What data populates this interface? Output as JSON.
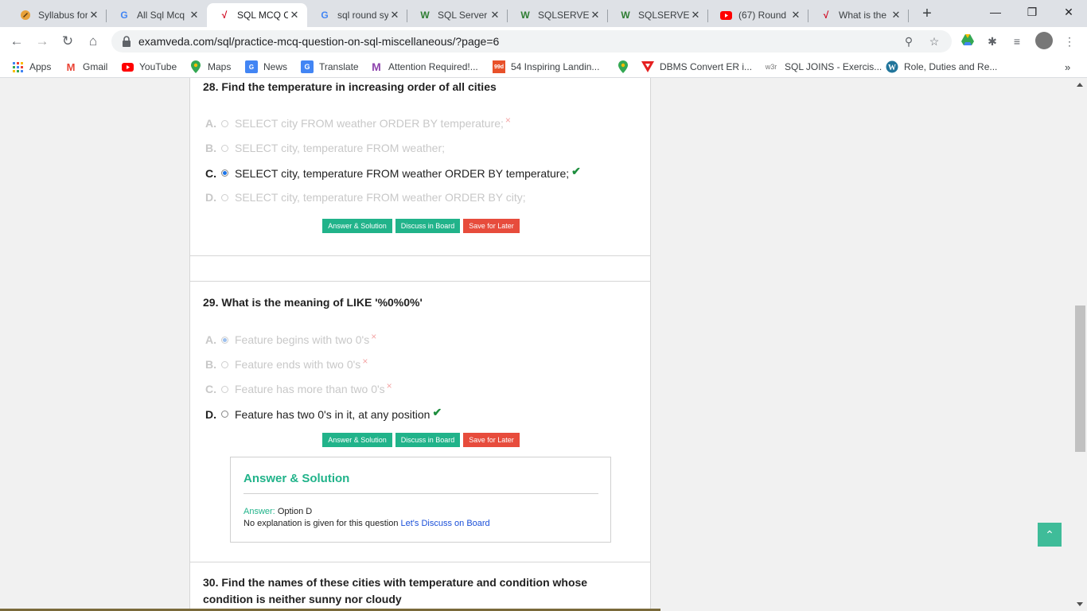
{
  "tabs": [
    {
      "title": "Syllabus for",
      "icon": "syllabus-icon",
      "active": false
    },
    {
      "title": "All Sql Mcq",
      "icon": "google-icon",
      "active": false
    },
    {
      "title": "SQL MCQ C",
      "icon": "examveda-icon",
      "active": true
    },
    {
      "title": "sql round sy",
      "icon": "google-icon",
      "active": false
    },
    {
      "title": "SQL Server",
      "icon": "w3-icon",
      "active": false
    },
    {
      "title": "SQLSERVER",
      "icon": "w3-icon",
      "active": false
    },
    {
      "title": "SQLSERVER",
      "icon": "w3-icon",
      "active": false
    },
    {
      "title": "(67) Round",
      "icon": "youtube-icon",
      "active": false
    },
    {
      "title": "What is the",
      "icon": "examveda-icon",
      "active": false
    }
  ],
  "address_bar": {
    "url": "examveda.com/sql/practice-mcq-question-on-sql-miscellaneous/?page=6"
  },
  "bookmarks": [
    {
      "label": "Apps",
      "icon": "apps-grid-icon"
    },
    {
      "label": "Gmail",
      "icon": "gmail-icon"
    },
    {
      "label": "YouTube",
      "icon": "youtube-icon"
    },
    {
      "label": "Maps",
      "icon": "maps-pin-icon"
    },
    {
      "label": "News",
      "icon": "news-icon"
    },
    {
      "label": "Translate",
      "icon": "translate-icon"
    },
    {
      "label": "Attention Required!...",
      "icon": "attention-icon"
    },
    {
      "label": "54 Inspiring Landin...",
      "icon": "99d-icon"
    },
    {
      "label": "",
      "icon": "maps-pin-icon"
    },
    {
      "label": "DBMS Convert ER i...",
      "icon": "dbms-icon"
    },
    {
      "label": "SQL JOINS - Exercis...",
      "icon": "w3r-icon"
    },
    {
      "label": "Role, Duties and Re...",
      "icon": "wordpress-icon"
    }
  ],
  "q28": {
    "title": "28. Find the temperature in increasing order of all cities",
    "options": [
      {
        "letter": "A.",
        "text": "SELECT city FROM weather ORDER BY temperature;",
        "mark": "×"
      },
      {
        "letter": "B.",
        "text": "SELECT city, temperature FROM weather;",
        "mark": ""
      },
      {
        "letter": "C.",
        "text": "SELECT city, temperature FROM weather ORDER BY temperature;",
        "mark": "✔"
      },
      {
        "letter": "D.",
        "text": "SELECT city, temperature FROM weather ORDER BY city;",
        "mark": ""
      }
    ]
  },
  "q29": {
    "title": "29. What is the meaning of LIKE '%0%0%'",
    "options": [
      {
        "letter": "A.",
        "text": "Feature begins with two 0's",
        "mark": "×"
      },
      {
        "letter": "B.",
        "text": "Feature ends with two 0's",
        "mark": "×"
      },
      {
        "letter": "C.",
        "text": "Feature has more than two 0's",
        "mark": "×"
      },
      {
        "letter": "D.",
        "text": "Feature has two 0's in it, at any position",
        "mark": "✔"
      }
    ],
    "answer_box": {
      "heading": "Answer & Solution",
      "answer_key": "Answer:",
      "answer_value": "Option D",
      "explanation": "No explanation is given for this question",
      "discuss_link": "Let's Discuss on Board"
    }
  },
  "q30": {
    "title": "30. Find the names of these cities with temperature and condition whose condition is neither sunny nor cloudy"
  },
  "buttons": {
    "answer": "Answer & Solution",
    "discuss": "Discuss in Board",
    "save": "Save for Later"
  },
  "colors": {
    "accent_green": "#21b38a",
    "save_red": "#e74c3c",
    "correct_check": "#1e8e3e",
    "wrong_x": "#f4a6a6"
  }
}
